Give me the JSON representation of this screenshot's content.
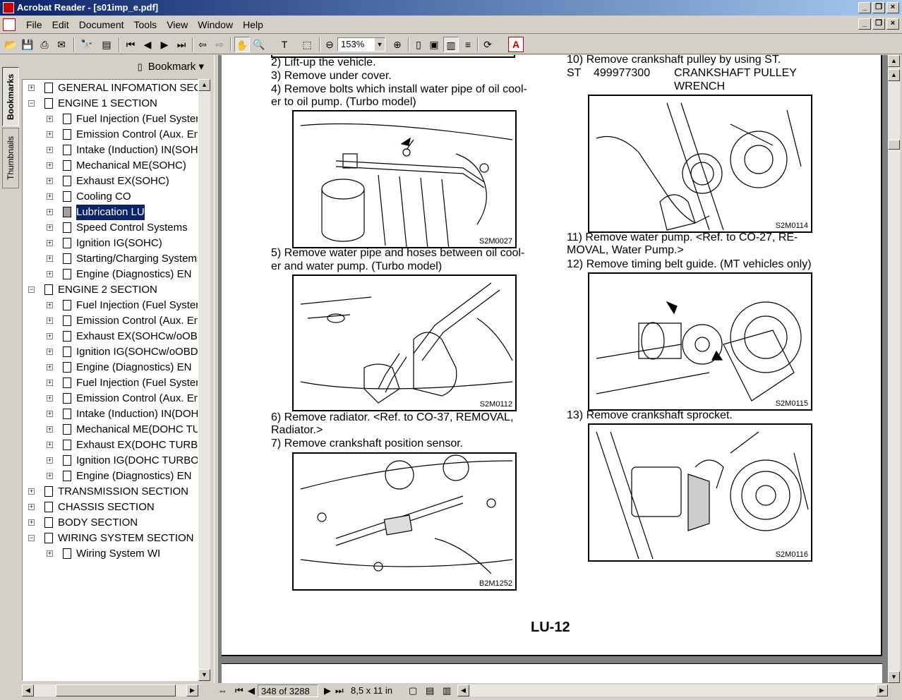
{
  "window": {
    "title": "Acrobat Reader - [s01imp_e.pdf]"
  },
  "menu": [
    "File",
    "Edit",
    "Document",
    "Tools",
    "View",
    "Window",
    "Help"
  ],
  "toolbar": {
    "zoom": "153%"
  },
  "side_tabs": {
    "bookmarks": "Bookmarks",
    "thumbnails": "Thumbnails"
  },
  "bookmarks": {
    "header": "Bookmark",
    "items": [
      {
        "label": "GENERAL INFOMATION SECTION",
        "level": 0,
        "expand": "+"
      },
      {
        "label": "ENGINE 1 SECTION",
        "level": 0,
        "expand": "-"
      },
      {
        "label": "Fuel Injection (Fuel Systems) FU",
        "level": 1,
        "expand": "+"
      },
      {
        "label": "Emission Control (Aux. Emission)",
        "level": 1,
        "expand": "+"
      },
      {
        "label": "Intake (Induction) IN(SOHC)",
        "level": 1,
        "expand": "+"
      },
      {
        "label": "Mechanical ME(SOHC)",
        "level": 1,
        "expand": "+"
      },
      {
        "label": "Exhaust EX(SOHC)",
        "level": 1,
        "expand": "+"
      },
      {
        "label": "Cooling CO",
        "level": 1,
        "expand": "+"
      },
      {
        "label": "Lubrication LU",
        "level": 1,
        "expand": "+",
        "selected": true
      },
      {
        "label": "Speed Control Systems",
        "level": 1,
        "expand": "+"
      },
      {
        "label": "Ignition IG(SOHC)",
        "level": 1,
        "expand": "+"
      },
      {
        "label": "Starting/Charging Systems",
        "level": 1,
        "expand": "+"
      },
      {
        "label": "Engine (Diagnostics) EN",
        "level": 1,
        "expand": "+"
      },
      {
        "label": "ENGINE 2 SECTION",
        "level": 0,
        "expand": "-"
      },
      {
        "label": "Fuel Injection (Fuel Systems)",
        "level": 1,
        "expand": "+"
      },
      {
        "label": "Emission Control (Aux. Emission)",
        "level": 1,
        "expand": "+"
      },
      {
        "label": "Exhaust EX(SOHCw/oOBD)",
        "level": 1,
        "expand": "+"
      },
      {
        "label": "Ignition IG(SOHCw/oOBD)",
        "level": 1,
        "expand": "+"
      },
      {
        "label": "Engine (Diagnostics) EN",
        "level": 1,
        "expand": "+"
      },
      {
        "label": "Fuel Injection (Fuel Systems)",
        "level": 1,
        "expand": "+"
      },
      {
        "label": "Emission Control (Aux. Emission)",
        "level": 1,
        "expand": "+"
      },
      {
        "label": "Intake (Induction) IN(DOHC)",
        "level": 1,
        "expand": "+"
      },
      {
        "label": "Mechanical ME(DOHC TURBO)",
        "level": 1,
        "expand": "+"
      },
      {
        "label": "Exhaust EX(DOHC TURBO)",
        "level": 1,
        "expand": "+"
      },
      {
        "label": "Ignition IG(DOHC TURBO)",
        "level": 1,
        "expand": "+"
      },
      {
        "label": "Engine (Diagnostics) EN",
        "level": 1,
        "expand": "+"
      },
      {
        "label": "TRANSMISSION SECTION",
        "level": 0,
        "expand": "+"
      },
      {
        "label": "CHASSIS SECTION",
        "level": 0,
        "expand": "+"
      },
      {
        "label": "BODY SECTION",
        "level": 0,
        "expand": "+"
      },
      {
        "label": "WIRING SYSTEM SECTION",
        "level": 0,
        "expand": "-"
      },
      {
        "label": "Wiring System WI",
        "level": 1,
        "expand": "+"
      }
    ]
  },
  "document": {
    "left": {
      "step2": "2) Lift-up the vehicle.",
      "step3": "3) Remove under cover.",
      "step4a": "4) Remove bolts which install water pipe of oil cool-",
      "step4b": "er to oil pump. (Turbo model)",
      "fig1": "S2M0027",
      "step5a": "5) Remove water pipe and hoses between oil cool-",
      "step5b": "er and water pump. (Turbo model)",
      "fig2": "S2M0112",
      "step6a": "6) Remove radiator.   <Ref. to CO-37, REMOVAL,",
      "step6b": "Radiator.>",
      "step7": "7) Remove crankshaft position sensor.",
      "fig3": "B2M1252"
    },
    "right": {
      "step10": "10) Remove crankshaft pulley by using ST.",
      "st_label": "ST",
      "st_number": "499977300",
      "st_name1": "CRANKSHAFT PULLEY",
      "st_name2": "WRENCH",
      "fig4": "S2M0114",
      "step11a": "11)  Remove  water  pump.    <Ref.  to  CO-27,  RE-",
      "step11b": "MOVAL, Water Pump.>",
      "step12": "12) Remove timing belt guide. (MT vehicles only)",
      "fig5": "S2M0115",
      "step13": "13) Remove crankshaft sprocket.",
      "fig6": "S2M0116"
    },
    "page_label": "LU-12"
  },
  "status": {
    "page": "348 of 3288",
    "size": "8,5 x 11 in"
  }
}
